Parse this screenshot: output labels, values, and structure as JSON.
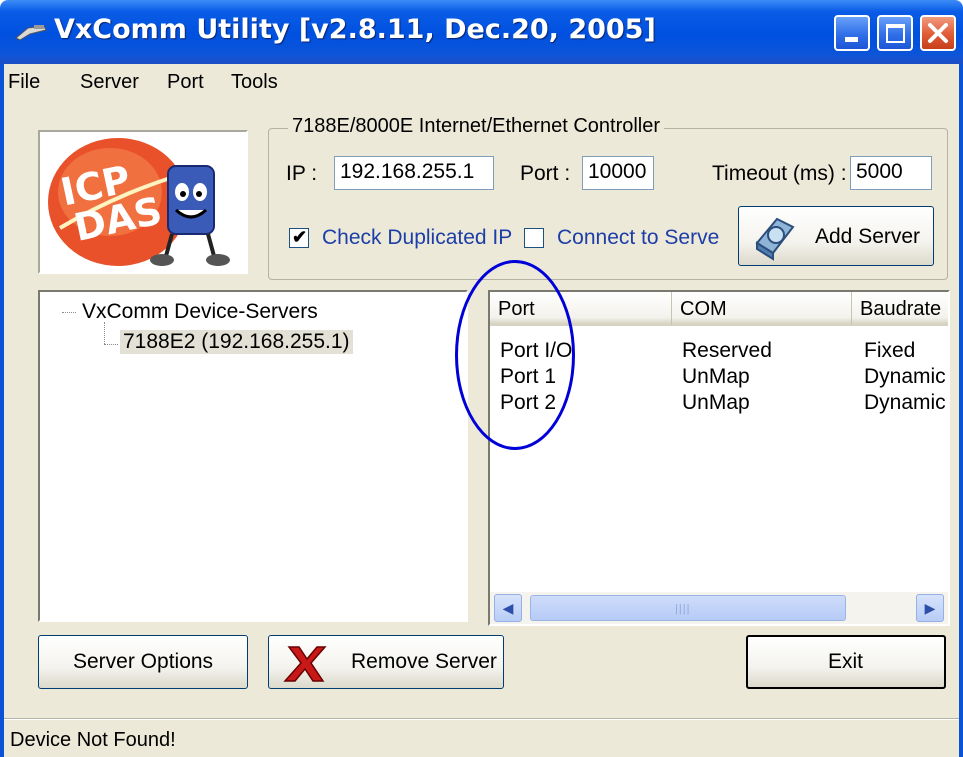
{
  "window": {
    "title": "VxComm Utility [v2.8.11, Dec.20, 2005]",
    "colors": {
      "titlebar": "#0050e0",
      "face": "#ece9d8",
      "link_text": "#1d3ea8",
      "annotation": "#0000d8"
    }
  },
  "menu": [
    "File",
    "Server",
    "Port",
    "Tools"
  ],
  "logo": {
    "text_line1": "ICP",
    "text_line2": "DAS"
  },
  "controller": {
    "group_title": "7188E/8000E Internet/Ethernet Controller",
    "ip_label": "IP :",
    "ip_value": "192.168.255.1",
    "port_label": "Port :",
    "port_value": "10000",
    "timeout_label": "Timeout (ms) :",
    "timeout_value": "5000",
    "check_duplicated_label": "Check Duplicated IP",
    "check_duplicated_checked": true,
    "connect_label": "Connect to Serve",
    "connect_checked": false,
    "add_server_label": "Add Server"
  },
  "tree": {
    "root_label": "VxComm Device-Servers",
    "child_label": "7188E2 (192.168.255.1)"
  },
  "ports_table": {
    "columns": [
      "Port",
      "COM",
      "Baudrate"
    ],
    "rows": [
      [
        "Port I/O",
        "Reserved",
        "Fixed"
      ],
      [
        "Port 1",
        "UnMap",
        "Dynamic"
      ],
      [
        "Port 2",
        "UnMap",
        "Dynamic"
      ]
    ]
  },
  "scrollbar": {
    "left_icon": "scroll-left-icon",
    "right_icon": "scroll-right-icon"
  },
  "buttons": {
    "server_options": "Server Options",
    "remove_server": "Remove Server",
    "exit": "Exit"
  },
  "status": "Device Not Found!"
}
